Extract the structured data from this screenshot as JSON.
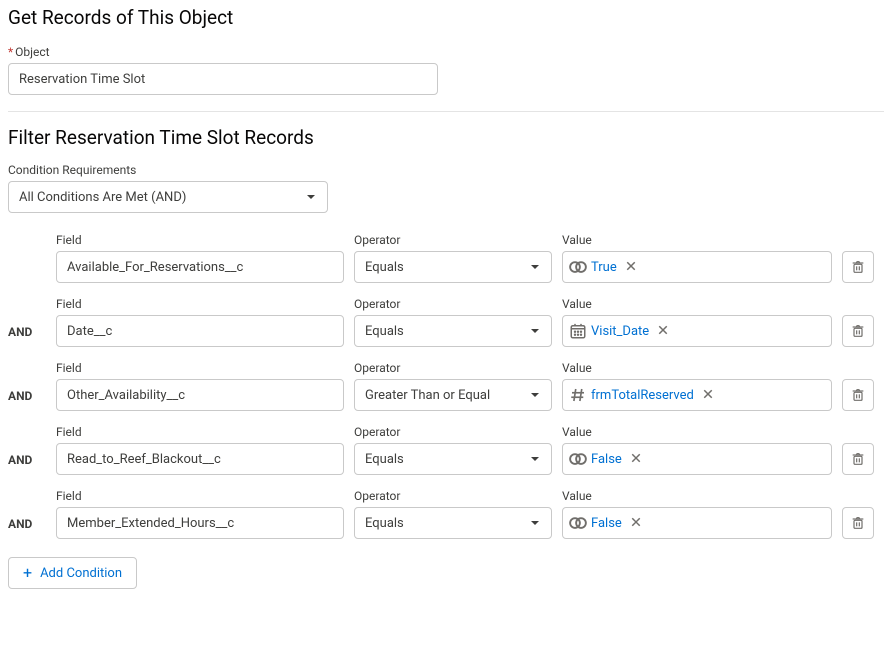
{
  "header": {
    "get_records_title": "Get Records of This Object",
    "object_label": "Object",
    "object_value": "Reservation Time Slot"
  },
  "filter": {
    "title": "Filter Reservation Time Slot Records",
    "cond_req_label": "Condition Requirements",
    "cond_req_value": "All Conditions Are Met (AND)",
    "logic_label": "AND",
    "col_field": "Field",
    "col_operator": "Operator",
    "col_value": "Value",
    "add_condition": "Add Condition",
    "rows": [
      {
        "field": "Available_For_Reservations__c",
        "operator": "Equals",
        "value_text": "True",
        "value_icon": "bool"
      },
      {
        "field": "Date__c",
        "operator": "Equals",
        "value_text": "Visit_Date",
        "value_icon": "date"
      },
      {
        "field": "Other_Availability__c",
        "operator": "Greater Than or Equal",
        "value_text": "frmTotalReserved",
        "value_icon": "number"
      },
      {
        "field": "Read_to_Reef_Blackout__c",
        "operator": "Equals",
        "value_text": "False",
        "value_icon": "bool"
      },
      {
        "field": "Member_Extended_Hours__c",
        "operator": "Equals",
        "value_text": "False",
        "value_icon": "bool"
      }
    ]
  }
}
